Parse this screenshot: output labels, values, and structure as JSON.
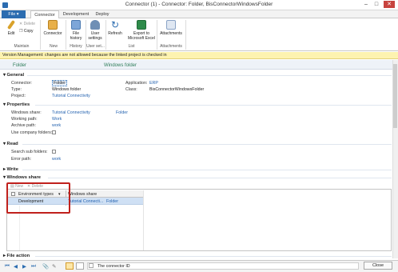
{
  "window": {
    "title": "Connector (1) - Connector: Folder, BisConnectorWindowsFolder"
  },
  "tabs": {
    "file": "File",
    "connector": "Connector",
    "development": "Development",
    "deploy": "Deploy"
  },
  "ribbon": {
    "edit": "Edit",
    "delete": "Delete",
    "copy": "Copy",
    "connector": "Connector",
    "file_history_1": "File",
    "file_history_2": "history",
    "user_settings_1": "User",
    "user_settings_2": "settings",
    "refresh": "Refresh",
    "export_1": "Export to",
    "export_2": "Microsoft Excel",
    "attachments": "Attachments",
    "groups": {
      "maintain": "Maintain",
      "new": "New",
      "history": "History",
      "user_set": "User set...",
      "list": "List",
      "attachments": "Attachments"
    }
  },
  "warning": "Version Management: changes are not allowed because the linked project is checked in",
  "header": {
    "left": "Folder",
    "right": "Windows folder"
  },
  "general": {
    "title": "General",
    "connector_label": "Connector:",
    "connector_value": "Folder",
    "type_label": "Type:",
    "type_value": "Windows folder",
    "project_label": "Project:",
    "project_value": "Tutorial Connectivity",
    "application_label": "Application:",
    "application_value": "ERP",
    "class_label": "Class:",
    "class_value": "BisConnectorWindowsFolder"
  },
  "properties": {
    "title": "Properties",
    "share_label": "Windows share:",
    "share_value1": "Tutorial Connectivity",
    "share_value2": "Folder",
    "working_label": "Working path:",
    "working_value": "Work",
    "archive_label": "Archive path:",
    "archive_value": "work",
    "company_label": "Use company folders:"
  },
  "read": {
    "title": "Read",
    "search_label": "Search sub folders:",
    "error_label": "Error path:",
    "error_value": "work"
  },
  "write": {
    "title": "Write"
  },
  "windows_share": {
    "title": "Windows share",
    "new": "New",
    "delete": "Delete",
    "col_env": "Environment types",
    "col_share": "Windows share",
    "row_env": "Development",
    "row_share1": "Tutorial Connecti...",
    "row_share2": "Folder"
  },
  "file_action": {
    "title": "File action"
  },
  "status": {
    "text": "The connector ID",
    "close": "Close"
  },
  "colors": {
    "accent": "#2b6cb0",
    "highlight": "#c0211d",
    "warning": "#fdf3b0"
  }
}
